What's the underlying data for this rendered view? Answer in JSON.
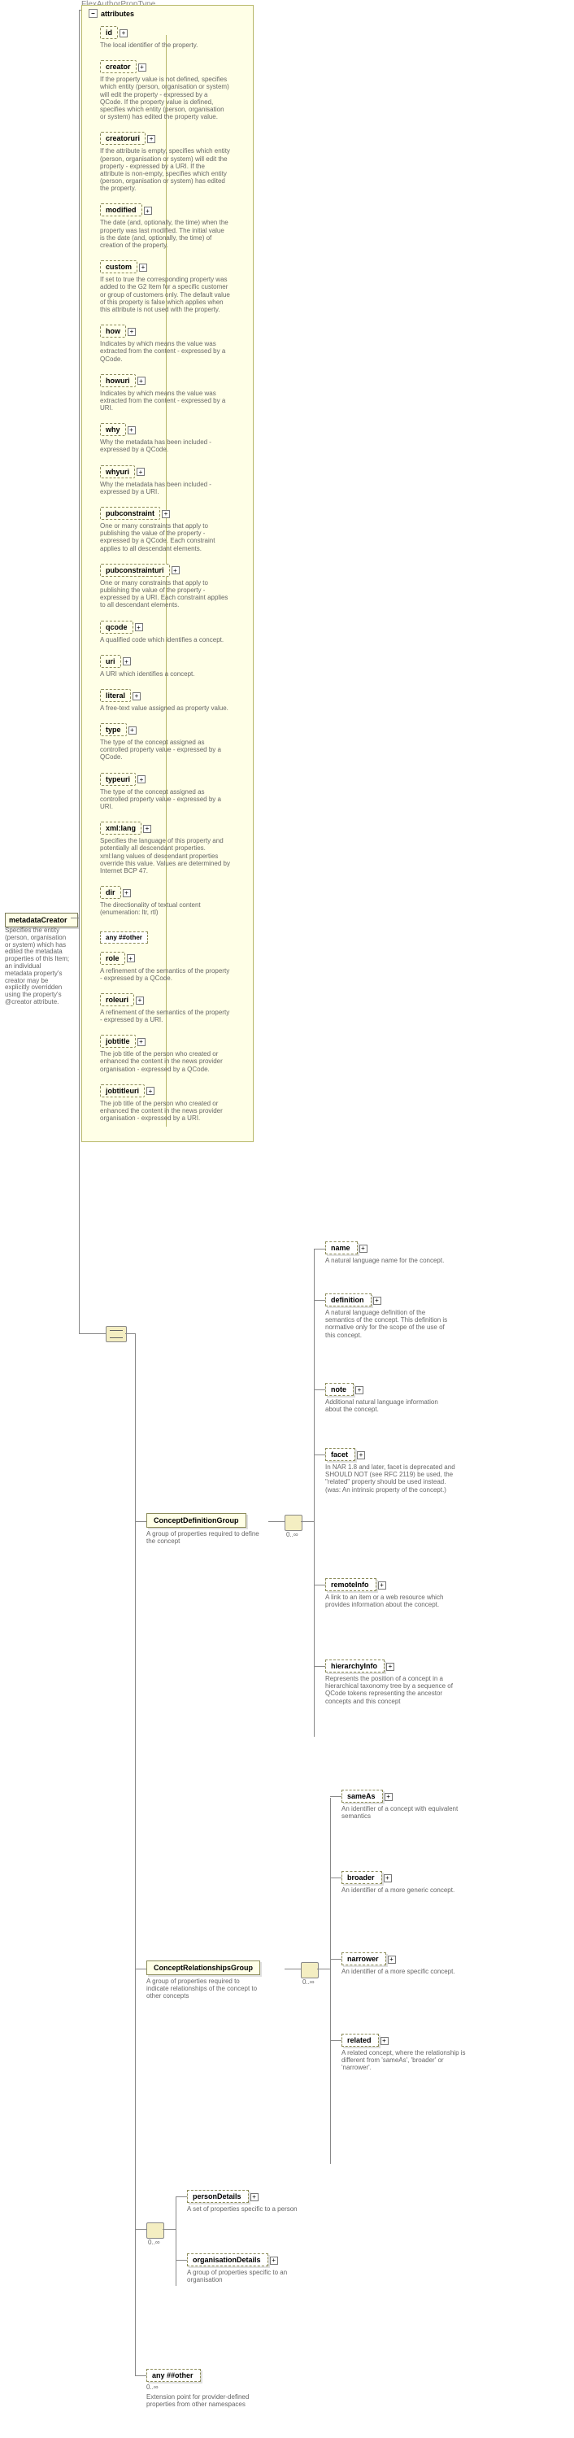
{
  "header": "FlexAuthorPropType",
  "root": {
    "name": "metadataCreator",
    "desc": "Specifies the entity (person, organisation or system) which has edited the metadata properties of this Item; an individual metadata property's creator may be explicitly overridden using the property's @creator attribute."
  },
  "attributes_label": "attributes",
  "attributes": [
    {
      "name": "id",
      "desc": "The local identifier of the property."
    },
    {
      "name": "creator",
      "desc": "If the property value is not defined, specifies which entity (person, organisation or system) will edit the property - expressed by a QCode. If the property value is defined, specifies which entity (person, organisation or system) has edited the property value."
    },
    {
      "name": "creatoruri",
      "desc": "If the attribute is empty, specifies which entity (person, organisation or system) will edit the property - expressed by a URI. If the attribute is non-empty, specifies which entity (person, organisation or system) has edited the property."
    },
    {
      "name": "modified",
      "desc": "The date (and, optionally, the time) when the property was last modified. The initial value is the date (and, optionally, the time) of creation of the property."
    },
    {
      "name": "custom",
      "desc": "If set to true the corresponding property was added to the G2 Item for a specific customer or group of customers only. The default value of this property is false which applies when this attribute is not used with the property."
    },
    {
      "name": "how",
      "desc": "Indicates by which means the value was extracted from the content - expressed by a QCode."
    },
    {
      "name": "howuri",
      "desc": "Indicates by which means the value was extracted from the content - expressed by a URI."
    },
    {
      "name": "why",
      "desc": "Why the metadata has been included - expressed by a QCode."
    },
    {
      "name": "whyuri",
      "desc": "Why the metadata has been included - expressed by a URI."
    },
    {
      "name": "pubconstraint",
      "desc": "One or many constraints that apply to publishing the value of the property - expressed by a QCode. Each constraint applies to all descendant elements."
    },
    {
      "name": "pubconstrainturi",
      "desc": "One or many constraints that apply to publishing the value of the property - expressed by a URI. Each constraint applies to all descendant elements."
    },
    {
      "name": "qcode",
      "desc": "A qualified code which identifies a concept."
    },
    {
      "name": "uri",
      "desc": "A URI which identifies a concept."
    },
    {
      "name": "literal",
      "desc": "A free-text value assigned as property value."
    },
    {
      "name": "type",
      "desc": "The type of the concept assigned as controlled property value - expressed by a QCode."
    },
    {
      "name": "typeuri",
      "desc": "The type of the concept assigned as controlled property value - expressed by a URI."
    },
    {
      "name": "xml:lang",
      "desc": "Specifies the language of this property and potentially all descendant properties. xml:lang values of descendant properties override this value. Values are determined by Internet BCP 47."
    },
    {
      "name": "dir",
      "desc": "The directionality of textual content (enumeration: ltr, rtl)"
    }
  ],
  "attr_any": "any ##other",
  "attributes2": [
    {
      "name": "role",
      "desc": "A refinement of the semantics of the property - expressed by a QCode."
    },
    {
      "name": "roleuri",
      "desc": "A refinement of the semantics of the property - expressed by a URI."
    },
    {
      "name": "jobtitle",
      "desc": "The job title of the person who created or enhanced the content in the news provider organisation - expressed by a QCode."
    },
    {
      "name": "jobtitleuri",
      "desc": "The job title of the person who created or enhanced the content in the news provider organisation - expressed by a URI."
    }
  ],
  "cdg": {
    "name": "ConceptDefinitionGroup",
    "desc": "A group of properties required to define the concept",
    "items": [
      {
        "name": "name",
        "desc": "A natural language name for the concept."
      },
      {
        "name": "definition",
        "desc": "A natural language definition of the semantics of the concept. This definition is normative only for the scope of the use of this concept."
      },
      {
        "name": "note",
        "desc": "Additional natural language information about the concept."
      },
      {
        "name": "facet",
        "desc": "In NAR 1.8 and later, facet is deprecated and SHOULD NOT (see RFC 2119) be used, the \"related\" property should be used instead. (was: An intrinsic property of the concept.)"
      },
      {
        "name": "remoteInfo",
        "desc": "A link to an item or a web resource which provides information about the concept."
      },
      {
        "name": "hierarchyInfo",
        "desc": "Represents the position of a concept in a hierarchical taxonomy tree by a sequence of QCode tokens representing the ancestor concepts and this concept"
      }
    ]
  },
  "crg": {
    "name": "ConceptRelationshipsGroup",
    "desc": "A group of properties required to indicate relationships of the concept to other concepts",
    "items": [
      {
        "name": "sameAs",
        "desc": "An identifier of a concept with equivalent semantics"
      },
      {
        "name": "broader",
        "desc": "An identifier of a more generic concept."
      },
      {
        "name": "narrower",
        "desc": "An identifier of a more specific concept."
      },
      {
        "name": "related",
        "desc": "A related concept, where the relationship is different from 'sameAs', 'broader' or 'narrower'."
      }
    ]
  },
  "details": [
    {
      "name": "personDetails",
      "desc": "A set of properties specific to a person"
    },
    {
      "name": "organisationDetails",
      "desc": "A group of properties specific to an organisation"
    }
  ],
  "ext": {
    "name": "any ##other",
    "desc": "Extension point for provider-defined properties from other namespaces"
  },
  "cards": {
    "zero_inf": "0..∞"
  },
  "minus": "–",
  "plus": "+"
}
